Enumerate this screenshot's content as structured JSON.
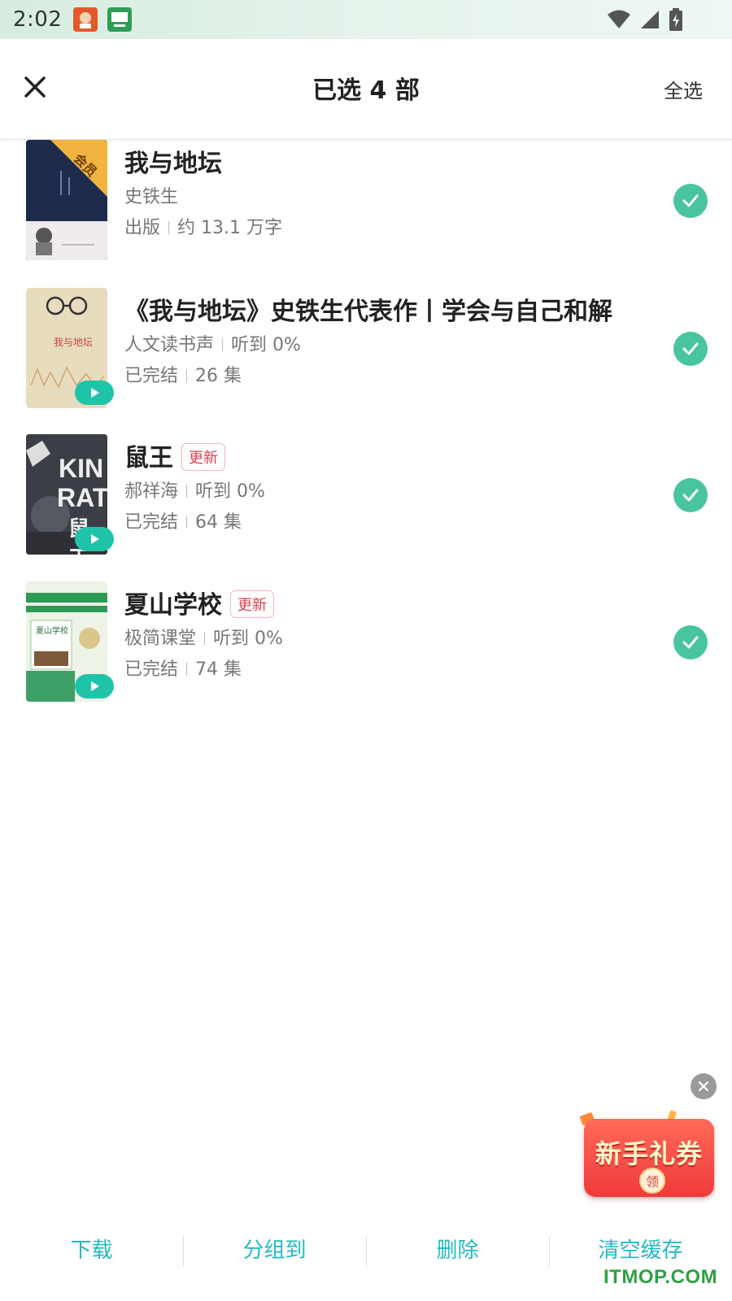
{
  "status_bar": {
    "time": "2:02"
  },
  "header": {
    "title": "已选 4 部",
    "select_all": "全选"
  },
  "items": [
    {
      "title": "我与地坛",
      "badge": "会员",
      "author": "史铁生",
      "info_a": "出版",
      "info_b": "约 13.1 万字",
      "selected": true
    },
    {
      "title": "《我与地坛》史铁生代表作丨学会与自己和解",
      "author": "人文读书声",
      "progress": "听到 0%",
      "status": "已完结",
      "episodes": "26 集",
      "cover_text": "我与地坛",
      "selected": true
    },
    {
      "title": "鼠王",
      "tag": "更新",
      "author": "郝祥海",
      "progress": "听到 0%",
      "status": "已完结",
      "episodes": "64 集",
      "cover_text_a": "KIN",
      "cover_text_b": "RAT",
      "cover_text_c": "鼠王",
      "selected": true
    },
    {
      "title": "夏山学校",
      "tag": "更新",
      "author": "极简课堂",
      "progress": "听到 0%",
      "status": "已完结",
      "episodes": "74 集",
      "cover_text": "夏山学校",
      "selected": true
    }
  ],
  "promo": {
    "text": "新手礼券",
    "claim": "领"
  },
  "bottom_bar": {
    "download": "下载",
    "group": "分组到",
    "delete": "删除",
    "clear_cache": "清空缓存"
  },
  "watermark": "ITMOP.COM",
  "colors": {
    "accent": "#25b9c4",
    "check": "#48c5a0",
    "tag": "#e0404f",
    "play": "#1fc4a8"
  }
}
